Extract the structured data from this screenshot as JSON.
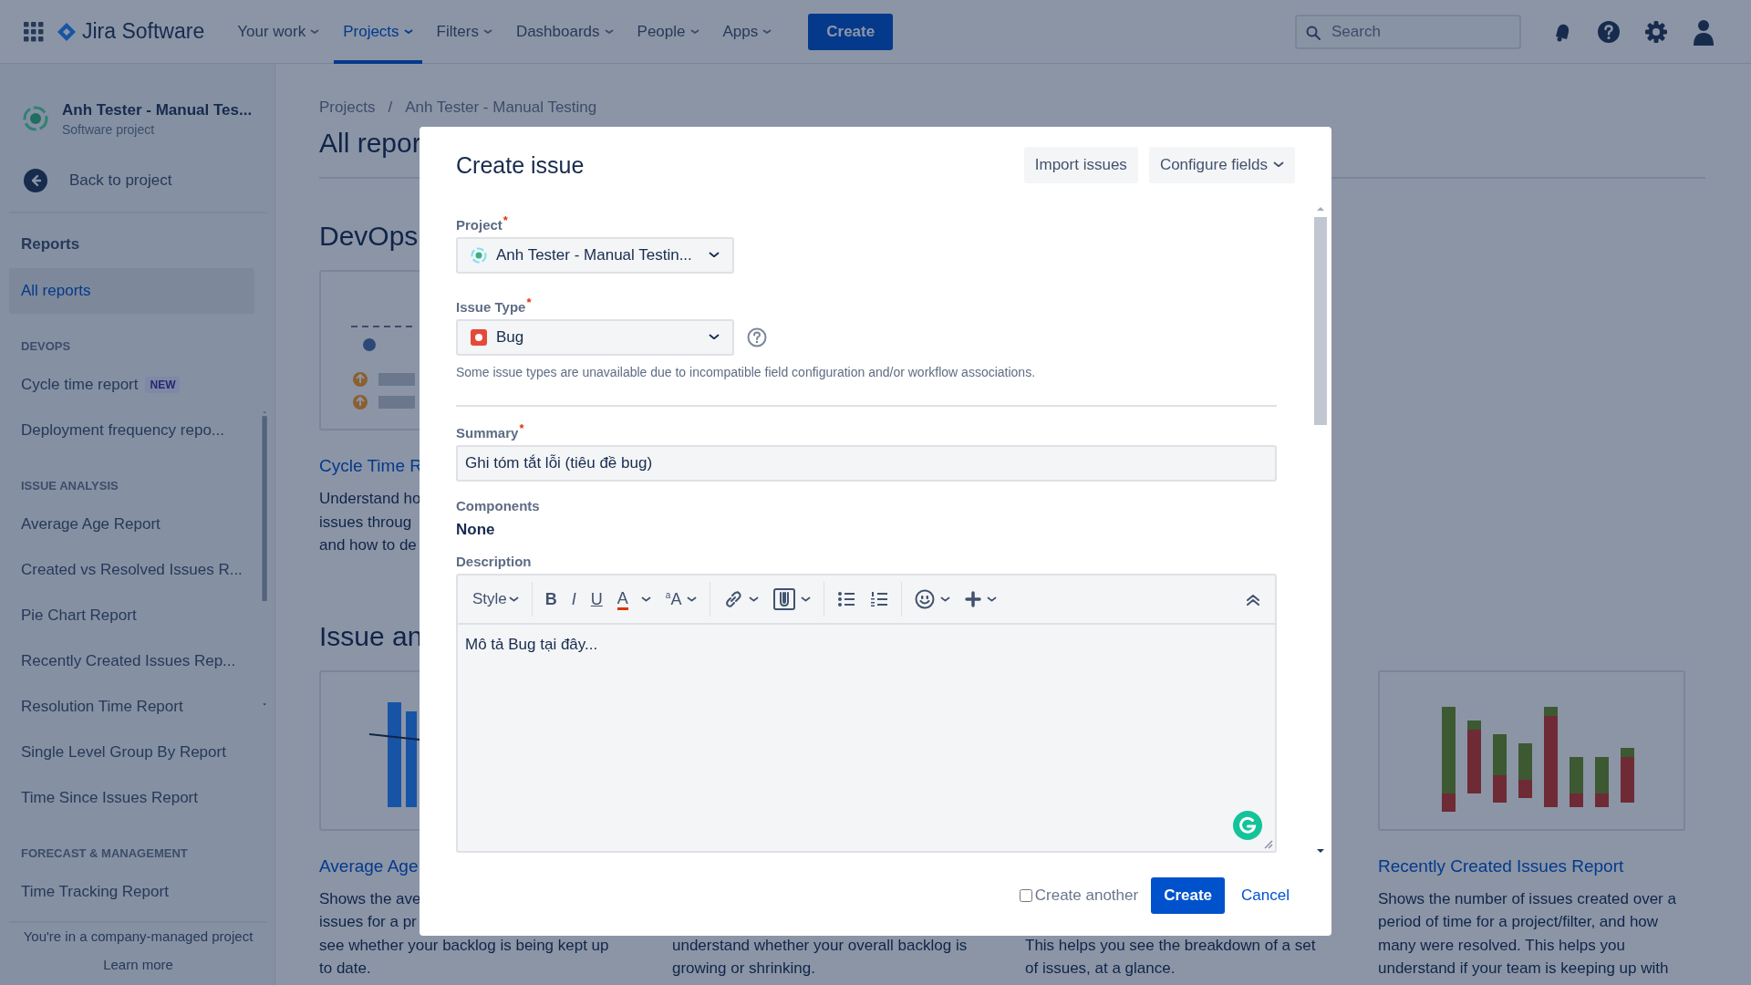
{
  "top_nav": {
    "app_name": "Jira Software",
    "menu": [
      {
        "label": "Your work",
        "selected": false
      },
      {
        "label": "Projects",
        "selected": true
      },
      {
        "label": "Filters",
        "selected": false
      },
      {
        "label": "Dashboards",
        "selected": false
      },
      {
        "label": "People",
        "selected": false
      },
      {
        "label": "Apps",
        "selected": false
      }
    ],
    "create_button": "Create",
    "search": {
      "placeholder": "Search"
    }
  },
  "sidebar": {
    "project": {
      "name": "Anh Tester - Manual Tes...",
      "type": "Software project"
    },
    "back_link": "Back to project",
    "items": [
      {
        "kind": "heading",
        "label": "Reports"
      },
      {
        "kind": "link",
        "label": "All reports",
        "selected": true
      },
      {
        "kind": "section",
        "label": "DEVOPS"
      },
      {
        "kind": "link",
        "label": "Cycle time report",
        "badge": "NEW",
        "selected": false
      },
      {
        "kind": "link",
        "label": "Deployment frequency repo...",
        "selected": false
      },
      {
        "kind": "section",
        "label": "ISSUE ANALYSIS"
      },
      {
        "kind": "link",
        "label": "Average Age Report",
        "selected": false
      },
      {
        "kind": "link",
        "label": "Created vs Resolved Issues R...",
        "selected": false
      },
      {
        "kind": "link",
        "label": "Pie Chart Report",
        "selected": false
      },
      {
        "kind": "link",
        "label": "Recently Created Issues Rep...",
        "selected": false
      },
      {
        "kind": "link",
        "label": "Resolution Time Report",
        "selected": false
      },
      {
        "kind": "link",
        "label": "Single Level Group By Report",
        "selected": false
      },
      {
        "kind": "link",
        "label": "Time Since Issues Report",
        "selected": false
      },
      {
        "kind": "section",
        "label": "FORECAST & MANAGEMENT"
      },
      {
        "kind": "link",
        "label": "Time Tracking Report",
        "selected": false
      }
    ],
    "footer_note": "You're in a company-managed project",
    "learn_more": "Learn more"
  },
  "main": {
    "breadcrumbs": [
      "Projects",
      "Anh Tester - Manual Testing"
    ],
    "breadcrumb_separator": "/",
    "page_title": "All repor",
    "groups": [
      {
        "title": "DevOps",
        "cards": [
          {
            "title": "Cycle Time R",
            "description_lines": [
              "Understand ho",
              "issues throug",
              "and how to de"
            ]
          }
        ]
      },
      {
        "title": "Issue an",
        "cards": [
          {
            "title": "Average Age",
            "description_lines": [
              "Shows the ave",
              "issues for a pr",
              "see whether your backlog is being kept up",
              "to date."
            ]
          },
          {
            "description_lines": [
              "understand whether your overall backlog is",
              "growing or shrinking."
            ]
          },
          {
            "description_lines": [
              "This helps you see the breakdown of a set",
              "of issues, at a glance."
            ]
          },
          {
            "title": "Recently Created Issues Report",
            "description_lines": [
              "Shows the number of issues created over a",
              "period of time for a project/filter, and how",
              "many were resolved. This helps you",
              "understand if your team is keeping up with"
            ]
          }
        ]
      }
    ]
  },
  "modal": {
    "title": "Create issue",
    "header_buttons": [
      {
        "label": "Import issues",
        "dropdown": false
      },
      {
        "label": "Configure fields",
        "dropdown": true
      }
    ],
    "fields": [
      {
        "kind": "select",
        "label": "Project",
        "required_mark": "*",
        "value": "Anh Tester - Manual Testin..."
      },
      {
        "kind": "select",
        "label": "Issue Type",
        "required_mark": "*",
        "value": "Bug",
        "help": true,
        "hint": "Some issue types are unavailable due to incompatible field configuration and/or workflow associations."
      },
      {
        "kind": "divider"
      },
      {
        "kind": "text",
        "label": "Summary",
        "required_mark": "*",
        "value": "Ghi tóm tắt lỗi (tiêu đề bug)"
      },
      {
        "kind": "static",
        "label": "Components",
        "value": "None"
      },
      {
        "kind": "editor",
        "label": "Description",
        "value": "Mô tả Bug tại đây...",
        "toolbar": [
          {
            "kind": "style",
            "label": "Style",
            "dropdown": true
          },
          {
            "kind": "separator"
          },
          {
            "kind": "bold",
            "label": "B",
            "dropdown": false
          },
          {
            "kind": "italic",
            "label": "I",
            "dropdown": false
          },
          {
            "kind": "underline",
            "label": "U",
            "dropdown": false
          },
          {
            "kind": "text-color",
            "label": "A",
            "dropdown": true
          },
          {
            "kind": "text-size",
            "label": "$^{a}$A",
            "dropdown": true
          },
          {
            "kind": "separator"
          },
          {
            "kind": "link",
            "dropdown": true
          },
          {
            "kind": "attachment",
            "dropdown": true
          },
          {
            "kind": "separator"
          },
          {
            "kind": "bullet-list",
            "dropdown": false
          },
          {
            "kind": "numbered-list",
            "dropdown": false
          },
          {
            "kind": "separator"
          },
          {
            "kind": "emoji",
            "dropdown": true
          },
          {
            "kind": "insert",
            "dropdown": true
          },
          {
            "kind": "collapse",
            "dropdown": false
          }
        ]
      }
    ],
    "footer": {
      "create_another": {
        "label": "Create another",
        "checked": false
      },
      "submit": "Create",
      "cancel": "Cancel"
    }
  }
}
